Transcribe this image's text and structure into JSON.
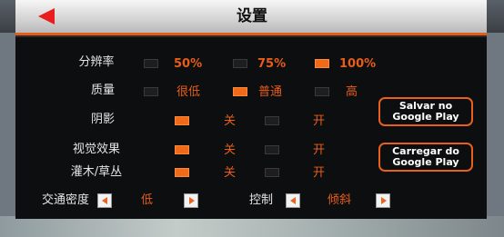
{
  "header": {
    "title": "设置",
    "back_icon": "back-arrow-icon"
  },
  "colors": {
    "accent": "#e85d1a",
    "toggle_on": "#f06a17",
    "panel": "#0d0e10"
  },
  "resolution": {
    "label": "分辨率",
    "options": [
      "50%",
      "75%",
      "100%"
    ],
    "selected": "100%"
  },
  "quality": {
    "label": "质量",
    "options": [
      "很低",
      "普通",
      "高"
    ],
    "selected": "普通"
  },
  "shadow": {
    "label": "阴影",
    "off": "关",
    "on": "开",
    "selected": "关"
  },
  "visual_effects": {
    "label": "视觉效果",
    "off": "关",
    "on": "开",
    "selected": "关"
  },
  "shrubs": {
    "label": "灌木/草丛",
    "off": "关",
    "on": "开",
    "selected": "关"
  },
  "traffic": {
    "label": "交通密度",
    "value": "低"
  },
  "control": {
    "label": "控制",
    "value": "倾斜"
  },
  "buttons": {
    "save_line1": "Salvar no",
    "save_line2": "Google Play",
    "load_line1": "Carregar do",
    "load_line2": "Google Play"
  }
}
